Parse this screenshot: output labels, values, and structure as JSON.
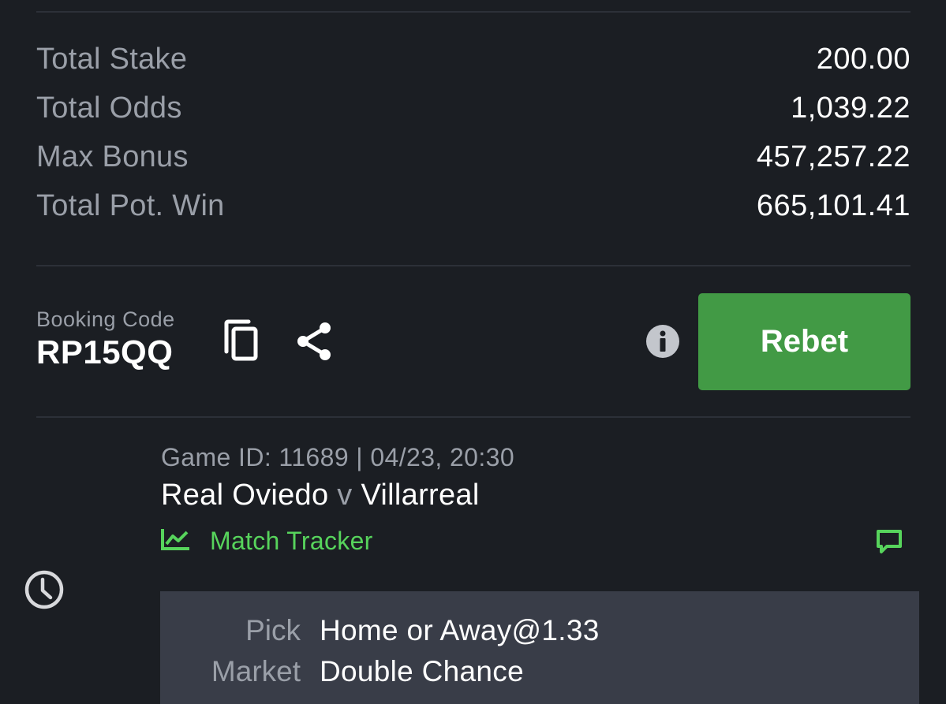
{
  "summary": {
    "rows": [
      {
        "label": "Total Stake",
        "value": "200.00"
      },
      {
        "label": "Total Odds",
        "value": "1,039.22"
      },
      {
        "label": "Max Bonus",
        "value": "457,257.22"
      },
      {
        "label": "Total Pot. Win",
        "value": "665,101.41"
      }
    ]
  },
  "booking": {
    "label": "Booking Code",
    "code": "RP15QQ"
  },
  "actions": {
    "rebet_label": "Rebet",
    "copy_icon": "copy-icon",
    "share_icon": "share-icon",
    "info_icon": "info-icon"
  },
  "game": {
    "meta": "Game ID: 11689 | 04/23, 20:30",
    "home": "Real Oviedo",
    "vs": "v",
    "away": "Villarreal",
    "tracker_label": "Match Tracker",
    "tracker_icon": "line-chart-icon",
    "chat_icon": "chat-bubble-icon",
    "status_icon": "clock-icon"
  },
  "detail": {
    "pick_label": "Pick",
    "pick_value": "Home or Away@1.33",
    "market_label": "Market",
    "market_value": "Double Chance"
  },
  "colors": {
    "background": "#1b1e23",
    "accent_green": "#429a45",
    "tracker_green": "#57d45c",
    "muted_text": "#9a9fa8",
    "detail_bg": "#393d48"
  }
}
